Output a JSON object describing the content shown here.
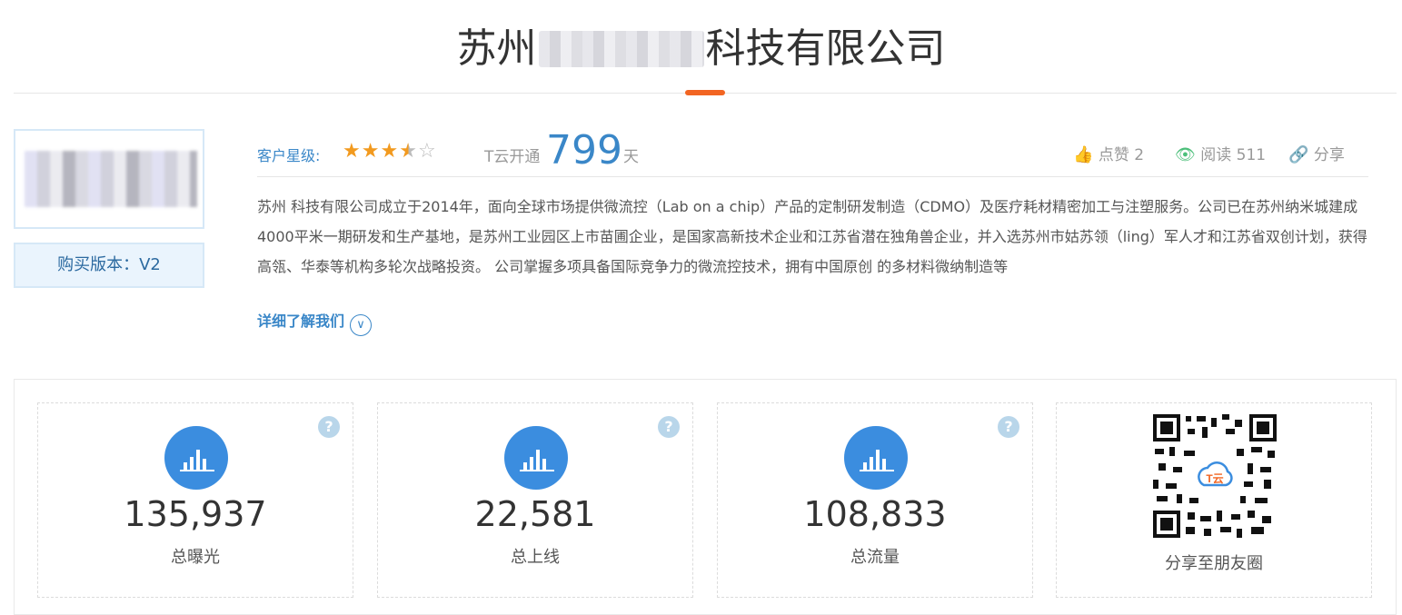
{
  "header": {
    "title_prefix": "苏州",
    "title_suffix": "科技有限公司"
  },
  "company": {
    "version_label": "购买版本：V2"
  },
  "meta": {
    "rating_label": "客户星级:",
    "rating": 3.5,
    "rating_max": 5,
    "tyun_label": "T云开通",
    "tyun_days": "799",
    "days_unit": "天",
    "like_label": "点赞 2",
    "read_label": "阅读 511",
    "share_label": "分享"
  },
  "description": {
    "text": "苏州           科技有限公司成立于2014年，面向全球市场提供微流控（Lab on a chip）产品的定制研发制造（CDMO）及医疗耗材精密加工与注塑服务。公司已在苏州纳米城建成4000平米一期研发和生产基地，是苏州工业园区上市苗圃企业，是国家高新技术企业和江苏省潜在独角兽企业，并入选苏州市姑苏领（ling）军人才和江苏省双创计划，获得高瓴、华泰等机构多轮次战略投资。 公司掌握多项具备国际竞争力的微流控技术，拥有中国原创 的多材料微纳制造等",
    "more_label": "详细了解我们"
  },
  "stats": [
    {
      "value": "135,937",
      "label": "总曝光"
    },
    {
      "value": "22,581",
      "label": "总上线"
    },
    {
      "value": "108,833",
      "label": "总流量"
    }
  ],
  "qr": {
    "label": "分享至朋友圈",
    "center_text": "T云"
  },
  "colors": {
    "accent": "#f26522",
    "primary_blue": "#3b8ddf",
    "star": "#f29a1f",
    "eye_green": "#4cbf7a"
  }
}
